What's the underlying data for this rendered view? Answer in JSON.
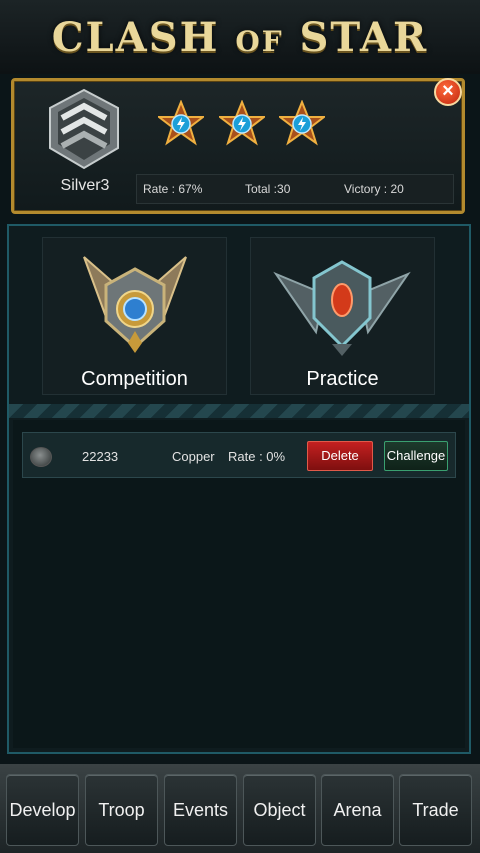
{
  "title": {
    "part1": "CLASH ",
    "part2": "OF",
    "part3": " STAR"
  },
  "close_icon": "close-icon",
  "profile": {
    "rank_name": "Silver3",
    "stars": 3,
    "stats": {
      "rate": "Rate : 67%",
      "total": "Total :30",
      "victory": "Victory : 20"
    }
  },
  "modes": {
    "competition": "Competition",
    "practice": "Practice"
  },
  "list": [
    {
      "id": "22233",
      "rank": "Copper",
      "rate": "Rate : 0%",
      "delete": "Delete",
      "challenge": "Challenge"
    }
  ],
  "nav": [
    "Develop",
    "Troop",
    "Events",
    "Object",
    "Arena",
    "Trade"
  ],
  "colors": {
    "gold": "#b38a2e",
    "teal": "#1f5a66",
    "delete": "#c42020",
    "challenge": "#3aa070"
  }
}
